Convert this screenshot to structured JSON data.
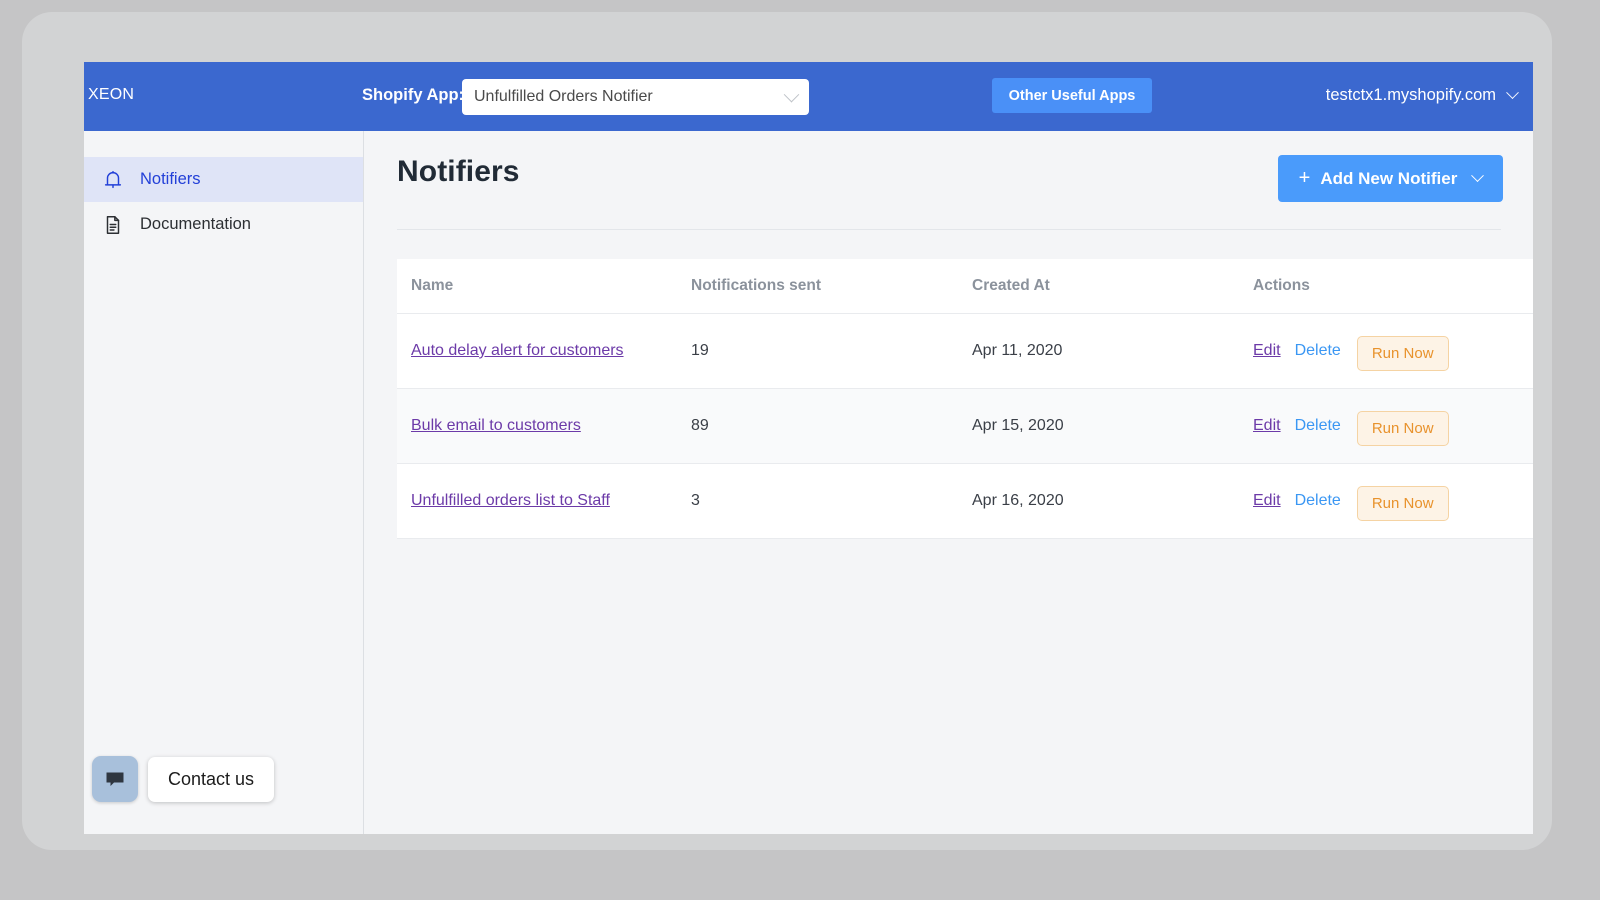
{
  "topbar": {
    "brand": "XEON",
    "shopify_app_label": "Shopify App:",
    "app_select_value": "Unfulfilled Orders Notifier",
    "other_apps_label": "Other Useful Apps",
    "shop_domain": "testctx1.myshopify.com",
    "background_color": "#3b68cf",
    "other_apps_color": "#4a90f7"
  },
  "sidebar": {
    "items": [
      {
        "label": "Notifiers",
        "icon": "bell-icon",
        "active": true
      },
      {
        "label": "Documentation",
        "icon": "document-icon",
        "active": false
      }
    ]
  },
  "chat": {
    "launcher_icon": "chat-bubble-icon",
    "label": "Contact us"
  },
  "main": {
    "page_title": "Notifiers",
    "add_button": {
      "plus": "+",
      "label": "Add New Notifier",
      "color": "#4a9bfb"
    }
  },
  "table": {
    "columns": [
      "Name",
      "Notifications sent",
      "Created At",
      "Actions"
    ],
    "actions": {
      "edit": "Edit",
      "delete": "Delete",
      "run_now": "Run Now"
    },
    "rows": [
      {
        "name": "Auto delay alert for customers",
        "notifications_sent": "19",
        "created_at": "Apr 11, 2020"
      },
      {
        "name": "Bulk email to customers",
        "notifications_sent": "89",
        "created_at": "Apr 15, 2020"
      },
      {
        "name": "Unfulfilled orders list to Staff",
        "notifications_sent": "3",
        "created_at": "Apr 16, 2020"
      }
    ]
  },
  "colors": {
    "accent_blue": "#3b68cf",
    "link_purple": "#6c3aa8",
    "link_blue": "#3b97f3",
    "run_orange": "#e8922c",
    "page_bg": "#f4f5f7"
  }
}
